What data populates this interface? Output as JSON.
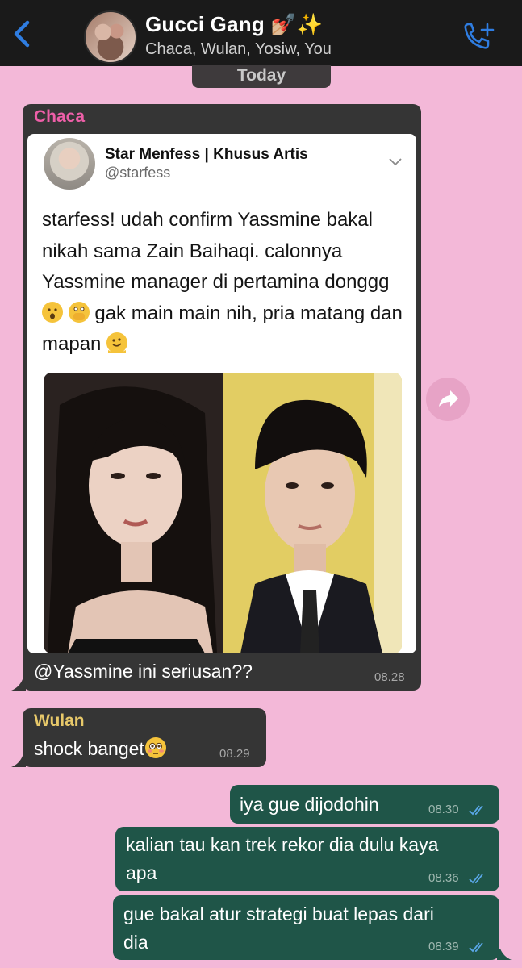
{
  "header": {
    "title": "Gucci Gang 💅🏼✨",
    "members": "Chaca, Wulan, Yosiw, You"
  },
  "date_divider": "Today",
  "messages": [
    {
      "sender": "Chaca",
      "sender_color": "#ee5fa8",
      "tweet": {
        "name": "Star Menfess | Khusus Artis",
        "handle": "@starfess",
        "text": "starfess! udah confirm Yassmine bakal nikah sama Zain Baihaqi. calonnya Yassmine manager di pertamina donggg",
        "text_mid": "gak main main nih,  pria matang dan mapan",
        "emoji_icons": [
          "hushed-face-icon",
          "face-with-open-eyes-and-hand-over-mouth-icon",
          "melting-face-icon"
        ]
      },
      "text": "@Yassmine ini seriusan??",
      "time": "08.28"
    },
    {
      "sender": "Wulan",
      "sender_color": "#e8c96a",
      "text": "shock banget",
      "emoji_icon": "flushed-face-icon",
      "time": "08.29"
    },
    {
      "text": "iya gue dijodohin",
      "time": "08.30",
      "status": "read"
    },
    {
      "text_line1": "kalian tau kan trek rekor dia dulu kaya",
      "text_line2": "apa",
      "time": "08.36",
      "status": "read"
    },
    {
      "text_line1": "gue bakal atur strategi buat lepas dari",
      "text_line2": "dia",
      "time": "08.39",
      "status": "read"
    }
  ],
  "colors": {
    "background": "#f3b8d8",
    "incoming_bubble": "#353535",
    "outgoing_bubble": "#1f5548",
    "accent": "#2f7de1",
    "read_ticks": "#5aa7e8"
  }
}
